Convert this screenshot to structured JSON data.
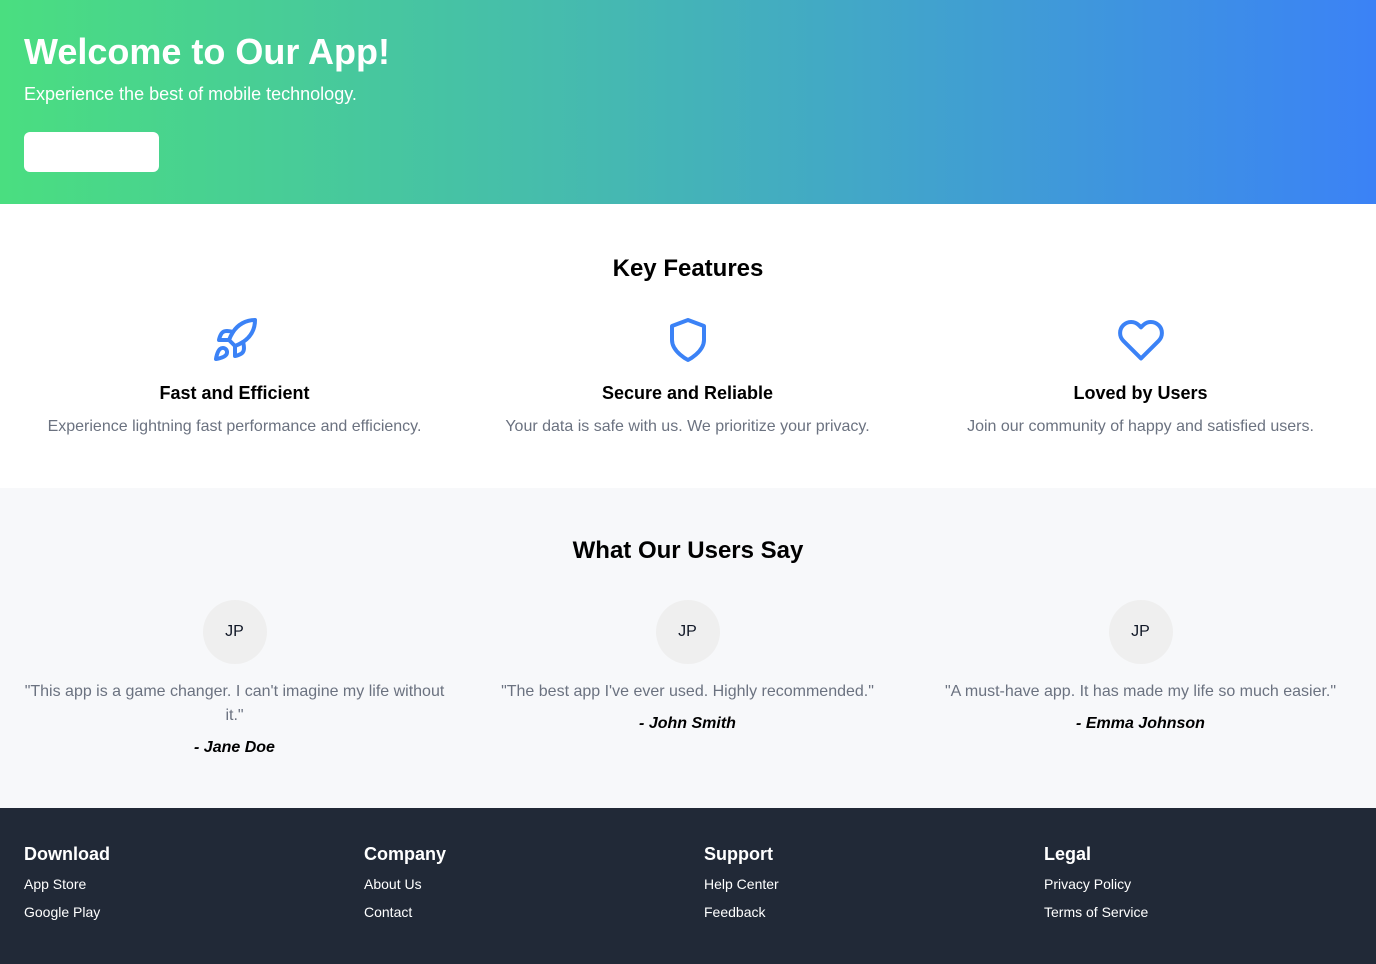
{
  "hero": {
    "title": "Welcome to Our App!",
    "subtitle": "Experience the best of mobile technology.",
    "button_label": ""
  },
  "features": {
    "title": "Key Features",
    "items": [
      {
        "icon": "rocket-icon",
        "title": "Fast and Efficient",
        "description": "Experience lightning fast performance and efficiency."
      },
      {
        "icon": "shield-icon",
        "title": "Secure and Reliable",
        "description": "Your data is safe with us. We prioritize your privacy."
      },
      {
        "icon": "heart-icon",
        "title": "Loved by Users",
        "description": "Join our community of happy and satisfied users."
      }
    ]
  },
  "testimonials": {
    "title": "What Our Users Say",
    "items": [
      {
        "initials": "JP",
        "quote": "\"This app is a game changer. I can't imagine my life without it.\"",
        "author": "- Jane Doe"
      },
      {
        "initials": "JP",
        "quote": "\"The best app I've ever used. Highly recommended.\"",
        "author": "- John Smith"
      },
      {
        "initials": "JP",
        "quote": "\"A must-have app. It has made my life so much easier.\"",
        "author": "- Emma Johnson"
      }
    ]
  },
  "footer": {
    "columns": [
      {
        "heading": "Download",
        "links": [
          "App Store",
          "Google Play"
        ]
      },
      {
        "heading": "Company",
        "links": [
          "About Us",
          "Contact"
        ]
      },
      {
        "heading": "Support",
        "links": [
          "Help Center",
          "Feedback"
        ]
      },
      {
        "heading": "Legal",
        "links": [
          "Privacy Policy",
          "Terms of Service"
        ]
      }
    ]
  },
  "colors": {
    "accent": "#3b82f6",
    "hero_gradient_start": "#4ade80",
    "hero_gradient_end": "#3b82f6",
    "footer_background": "#212937",
    "muted_text": "#6b7280"
  }
}
